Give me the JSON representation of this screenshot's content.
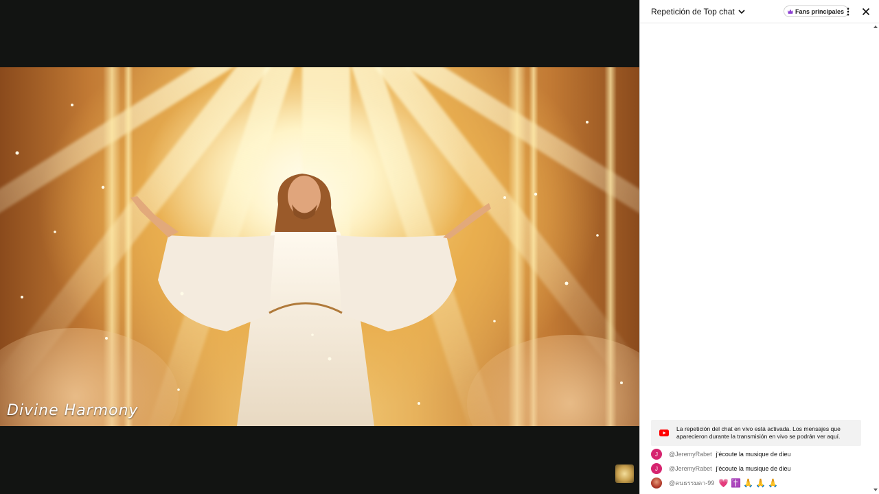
{
  "video": {
    "caption": "Divine Harmony"
  },
  "chat": {
    "title": "Repetición de Top chat",
    "fans_badge": "Fans principales",
    "notice": "La repetición del chat en vivo está activada. Los mensajes que aparecieron durante la transmisión en vivo se podrán ver aquí.",
    "messages": [
      {
        "avatar_letter": "J",
        "author": "@JeremyRabet",
        "text": "j'écoute la musique de dieu"
      },
      {
        "avatar_letter": "J",
        "author": "@JeremyRabet",
        "text": "j'écoute la musique de dieu"
      },
      {
        "avatar_letter": "",
        "author": "@คนธรรมดา-99",
        "emojis": [
          "💗",
          "✝️",
          "🙏",
          "🙏",
          "🙏"
        ]
      }
    ]
  },
  "colors": {
    "avatar": "#d6246f",
    "youtube_red": "#ff0000",
    "crown": "#8b3fd1"
  },
  "icons": [
    "chevron-down-icon",
    "crown-icon",
    "more-vert-icon",
    "close-icon",
    "youtube-icon",
    "scroll-up-icon",
    "scroll-down-icon"
  ]
}
